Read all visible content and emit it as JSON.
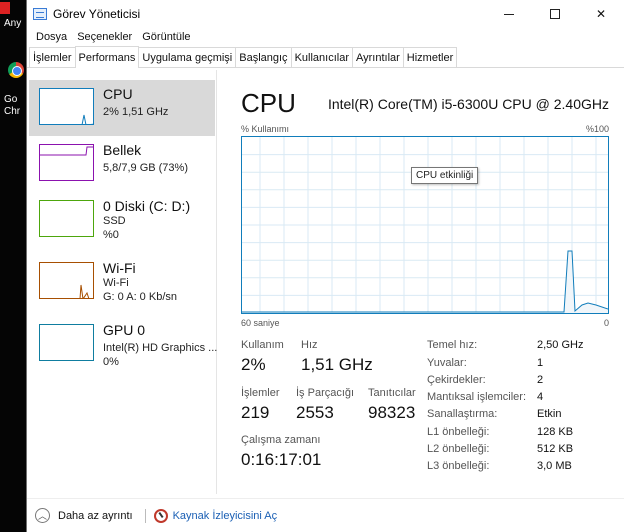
{
  "desktop": {
    "label_top": "Any",
    "label_google": "Go",
    "label_chrome": "Chr"
  },
  "window": {
    "title": "Görev Yöneticisi",
    "min_icon": "minimize-icon",
    "max_icon": "maximize-icon",
    "close_glyph": "✕"
  },
  "menu": [
    "Dosya",
    "Seçenekler",
    "Görüntüle"
  ],
  "tabs": [
    "İşlemler",
    "Performans",
    "Uygulama geçmişi",
    "Başlangıç",
    "Kullanıcılar",
    "Ayrıntılar",
    "Hizmetler"
  ],
  "active_tab": "Performans",
  "sidebar": {
    "items": [
      {
        "title": "CPU",
        "sub1": "2%  1,51 GHz",
        "sub2": "",
        "sub3": "",
        "color": "#117dbb"
      },
      {
        "title": "Bellek",
        "sub1": "5,8/7,9 GB (73%)",
        "sub2": "",
        "sub3": "",
        "color": "#8b12ae"
      },
      {
        "title": "0 Diski (C: D:)",
        "sub1": "SSD",
        "sub2": "%0",
        "sub3": "",
        "color": "#4da60c"
      },
      {
        "title": "Wi-Fi",
        "sub1": "Wi-Fi",
        "sub2": "G: 0  A: 0 Kb/sn",
        "sub3": "",
        "color": "#a74f01"
      },
      {
        "title": "GPU 0",
        "sub1": "Intel(R) HD Graphics ...",
        "sub2": "0%",
        "sub3": "",
        "color": "#0f7da0"
      }
    ]
  },
  "main": {
    "heading": "CPU",
    "model": "Intel(R) Core(TM) i5-6300U CPU @ 2.40GHz",
    "usage_label": "% Kullanımı",
    "max_label": "%100",
    "tooltip": "CPU etkinliği",
    "axis_left": "60 saniye",
    "axis_right": "0",
    "stats": {
      "kullanim_label": "Kullanım",
      "kullanim_value": "2%",
      "hiz_label": "Hız",
      "hiz_value": "1,51 GHz",
      "islemler_label": "İşlemler",
      "islemler_value": "219",
      "is_parcacigi_label": "İş Parçacığı",
      "is_parcacigi_value": "2553",
      "tanitici_label": "Tanıtıcılar",
      "tanitici_value": "98323",
      "calisma_label": "Çalışma zamanı",
      "calisma_value": "0:16:17:01"
    },
    "specs": [
      {
        "label": "Temel hız:",
        "value": "2,50 GHz"
      },
      {
        "label": "Yuvalar:",
        "value": "1"
      },
      {
        "label": "Çekirdekler:",
        "value": "2"
      },
      {
        "label": "Mantıksal işlemciler:",
        "value": "4"
      },
      {
        "label": "Sanallaştırma:",
        "value": "Etkin"
      },
      {
        "label": "L1 önbelleği:",
        "value": "128 KB"
      },
      {
        "label": "L2 önbelleği:",
        "value": "512 KB"
      },
      {
        "label": "L3 önbelleği:",
        "value": "3,0 MB"
      }
    ]
  },
  "footer": {
    "less_details": "Daha az ayrıntı",
    "resource_monitor": "Kaynak İzleyicisini Aç"
  },
  "colors": {
    "cpu_line": "#117dbb",
    "cpu_fill": "#f1f6fa",
    "grid": "#d9eaf4"
  }
}
